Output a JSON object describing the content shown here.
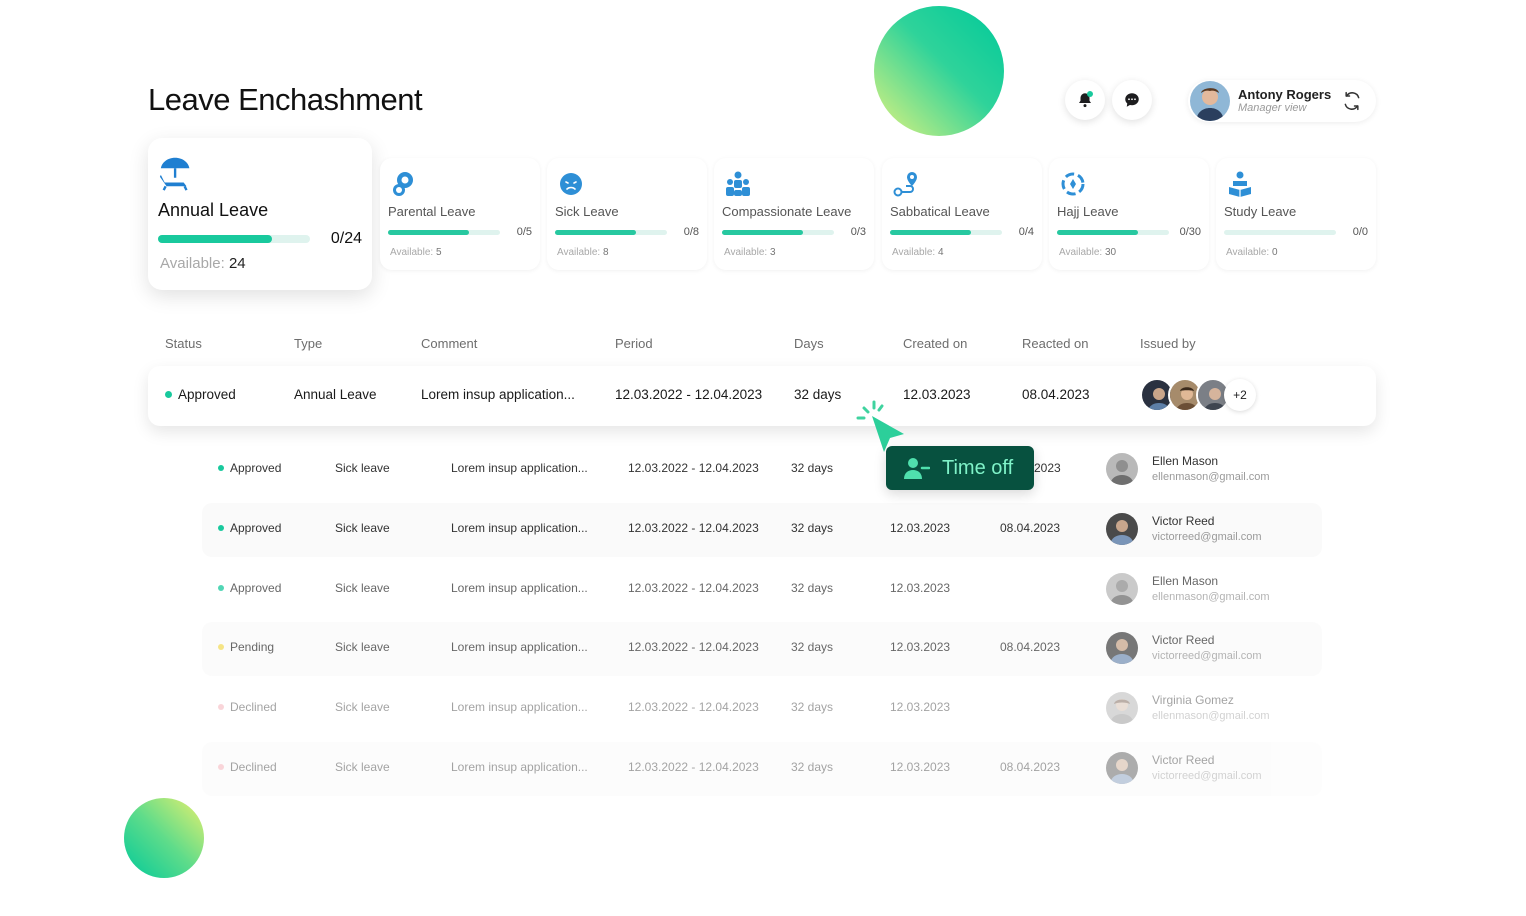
{
  "page": {
    "title": "Leave Enchashment"
  },
  "header": {
    "user": {
      "name": "Antony Rogers",
      "role": "Manager view"
    }
  },
  "leave_cards": [
    {
      "name": "Annual Leave",
      "count": "0/24",
      "available_label": "Available:",
      "available": "24",
      "progress": 0.75,
      "icon": "beach-umbrella-icon"
    },
    {
      "name": "Parental Leave",
      "count": "0/5",
      "available_label": "Available:",
      "available": "5",
      "progress": 0.72,
      "icon": "baby-icon"
    },
    {
      "name": "Sick Leave",
      "count": "0/8",
      "available_label": "Available:",
      "available": "8",
      "progress": 0.72,
      "icon": "sick-face-icon"
    },
    {
      "name": "Compassionate Leave",
      "count": "0/3",
      "available_label": "Available:",
      "available": "3",
      "progress": 0.72,
      "icon": "family-icon"
    },
    {
      "name": "Sabbatical Leave",
      "count": "0/4",
      "available_label": "Available:",
      "available": "4",
      "progress": 0.72,
      "icon": "route-pin-icon"
    },
    {
      "name": "Hajj Leave",
      "count": "0/30",
      "available_label": "Available:",
      "available": "30",
      "progress": 0.72,
      "icon": "circular-arrows-icon"
    },
    {
      "name": "Study Leave",
      "count": "0/0",
      "available_label": "Available:",
      "available": "0",
      "progress": 0.0,
      "icon": "reading-person-icon"
    }
  ],
  "table": {
    "headers": [
      "Status",
      "Type",
      "Comment",
      "Period",
      "Days",
      "Created on",
      "Reacted on",
      "Issued by"
    ],
    "main_row": {
      "status": "Approved",
      "type": "Annual Leave",
      "comment": "Lorem insup application...",
      "period": "12.03.2022 - 12.04.2023",
      "days": "32 days",
      "created": "12.03.2023",
      "reacted": "08.04.2023",
      "extra_count": "+2"
    },
    "rows": [
      {
        "status": "Approved",
        "type": "Sick leave",
        "comment": "Lorem insup application...",
        "period": "12.03.2022 - 12.04.2023",
        "days": "32 days",
        "created": "",
        "reacted": "2023",
        "issuer_name": "Ellen Mason",
        "issuer_email": "ellenmason@gmail.com"
      },
      {
        "status": "Approved",
        "type": "Sick leave",
        "comment": "Lorem insup application...",
        "period": "12.03.2022 - 12.04.2023",
        "days": "32 days",
        "created": "12.03.2023",
        "reacted": "08.04.2023",
        "issuer_name": "Victor Reed",
        "issuer_email": "victorreed@gmail.com"
      },
      {
        "status": "Approved",
        "type": "Sick leave",
        "comment": "Lorem insup application...",
        "period": "12.03.2022 - 12.04.2023",
        "days": "32 days",
        "created": "12.03.2023",
        "reacted": "",
        "issuer_name": "Ellen Mason",
        "issuer_email": "ellenmason@gmail.com"
      },
      {
        "status": "Pending",
        "type": "Sick leave",
        "comment": "Lorem insup application...",
        "period": "12.03.2022 - 12.04.2023",
        "days": "32 days",
        "created": "12.03.2023",
        "reacted": "08.04.2023",
        "issuer_name": "Victor Reed",
        "issuer_email": "victorreed@gmail.com"
      },
      {
        "status": "Declined",
        "type": "Sick leave",
        "comment": "Lorem insup application...",
        "period": "12.03.2022 - 12.04.2023",
        "days": "32 days",
        "created": "12.03.2023",
        "reacted": "",
        "issuer_name": "Virginia Gomez",
        "issuer_email": "ellenmason@gmail.com"
      },
      {
        "status": "Declined",
        "type": "Sick leave",
        "comment": "Lorem insup application...",
        "period": "12.03.2022 - 12.04.2023",
        "days": "32 days",
        "created": "12.03.2023",
        "reacted": "08.04.2023",
        "issuer_name": "Victor Reed",
        "issuer_email": "victorreed@gmail.com"
      }
    ]
  },
  "tooltip": {
    "label": "Time off"
  },
  "colors": {
    "approved": "#19c99d",
    "pending": "#f2dc5d",
    "declined": "#f3a3ad",
    "accent": "#19c99d",
    "tooltip_bg": "#07513f",
    "icon_blue": "#2e8fd6"
  }
}
